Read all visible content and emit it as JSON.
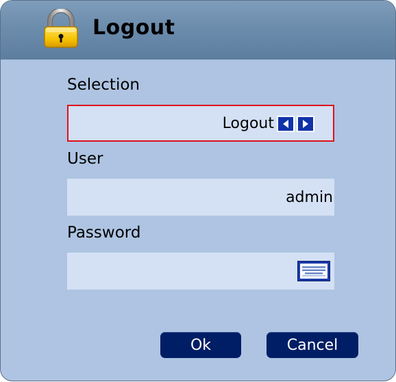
{
  "dialog": {
    "title": "Logout",
    "title_icon": "lock-icon"
  },
  "selection": {
    "label": "Selection",
    "value": "Logout",
    "prev_icon": "arrow-left-icon",
    "next_icon": "arrow-right-icon"
  },
  "user": {
    "label": "User",
    "value": "admin"
  },
  "password": {
    "label": "Password",
    "value": "",
    "keyboard_icon": "keyboard-icon"
  },
  "buttons": {
    "ok": "Ok",
    "cancel": "Cancel"
  },
  "colors": {
    "titlebar": "#6c8cac",
    "panel": "#aec4e2",
    "field": "#d4e0f4",
    "focus_border": "#e0101a",
    "button": "#001e65",
    "arrow_button": "#1033a8"
  }
}
